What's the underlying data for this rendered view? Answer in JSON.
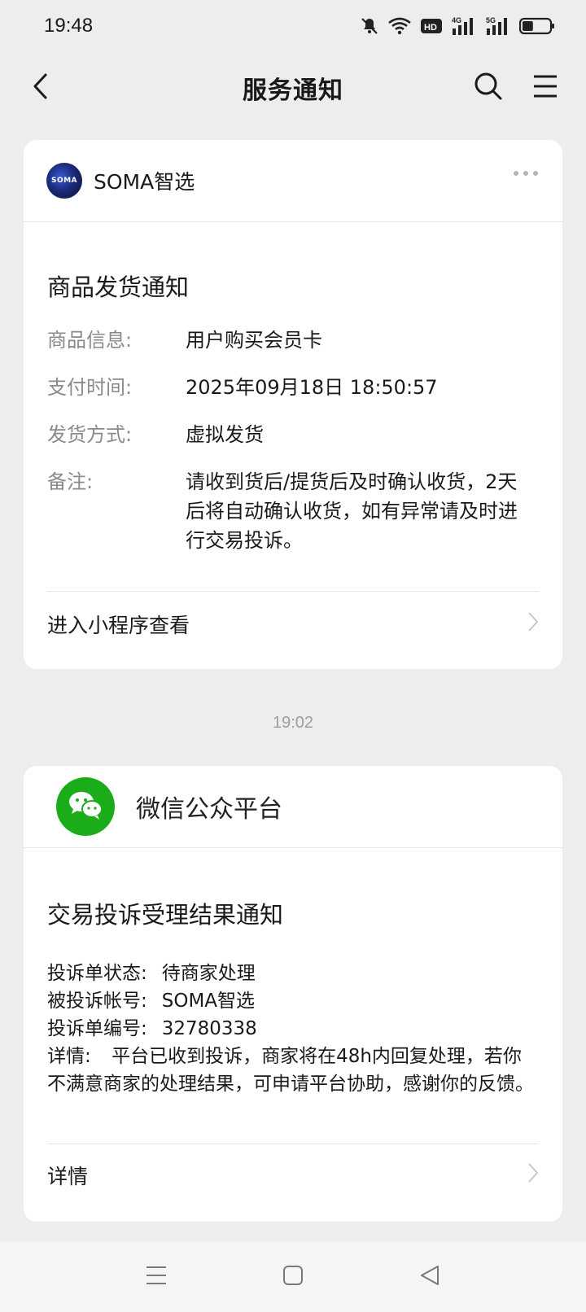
{
  "status_bar": {
    "time": "19:48",
    "icons": [
      "mute-bell-icon",
      "wifi-icon",
      "hd-icon",
      "4g-signal-icon",
      "5g-signal-icon",
      "battery-icon"
    ],
    "hd_label": "HD",
    "signal_4g_label": "4G",
    "signal_5g_label": "5G",
    "battery_level": 0.4
  },
  "nav": {
    "title": "服务通知",
    "back_icon": "chevron-left-icon",
    "search_icon": "search-icon",
    "menu_icon": "menu-icon"
  },
  "messages": [
    {
      "sender": "SOMA智选",
      "avatar_text": "SOMA",
      "title": "商品发货通知",
      "fields": [
        {
          "label": "商品信息:",
          "value": "用户购买会员卡"
        },
        {
          "label": "支付时间:",
          "value": "2025年09月18日 18:50:57"
        },
        {
          "label": "发货方式:",
          "value": "虚拟发货"
        },
        {
          "label": "备注:",
          "value": "请收到货后/提货后及时确认收货，2天后将自动确认收货，如有异常请及时进行交易投诉。"
        }
      ],
      "link": "进入小程序查看"
    },
    {
      "timestamp": "19:02",
      "sender": "微信公众平台",
      "title": "交易投诉受理结果通知",
      "fields": [
        {
          "label": "投诉单状态:",
          "value": "待商家处理"
        },
        {
          "label": "被投诉帐号:",
          "value": "SOMA智选"
        },
        {
          "label": "投诉单编号:",
          "value": "32780338"
        },
        {
          "label": "详情:",
          "value": "平台已收到投诉，商家将在48h内回复处理，若你不满意商家的处理结果，可申请平台协助，感谢你的反馈。"
        }
      ],
      "link": "详情"
    }
  ],
  "bottom_nav": {
    "icons": [
      "menu-lines-icon",
      "home-square-icon",
      "back-triangle-icon"
    ]
  },
  "colors": {
    "background": "#ededed",
    "card": "#ffffff",
    "wechat_green": "#1aad19",
    "label_gray": "#8a8a8a"
  }
}
